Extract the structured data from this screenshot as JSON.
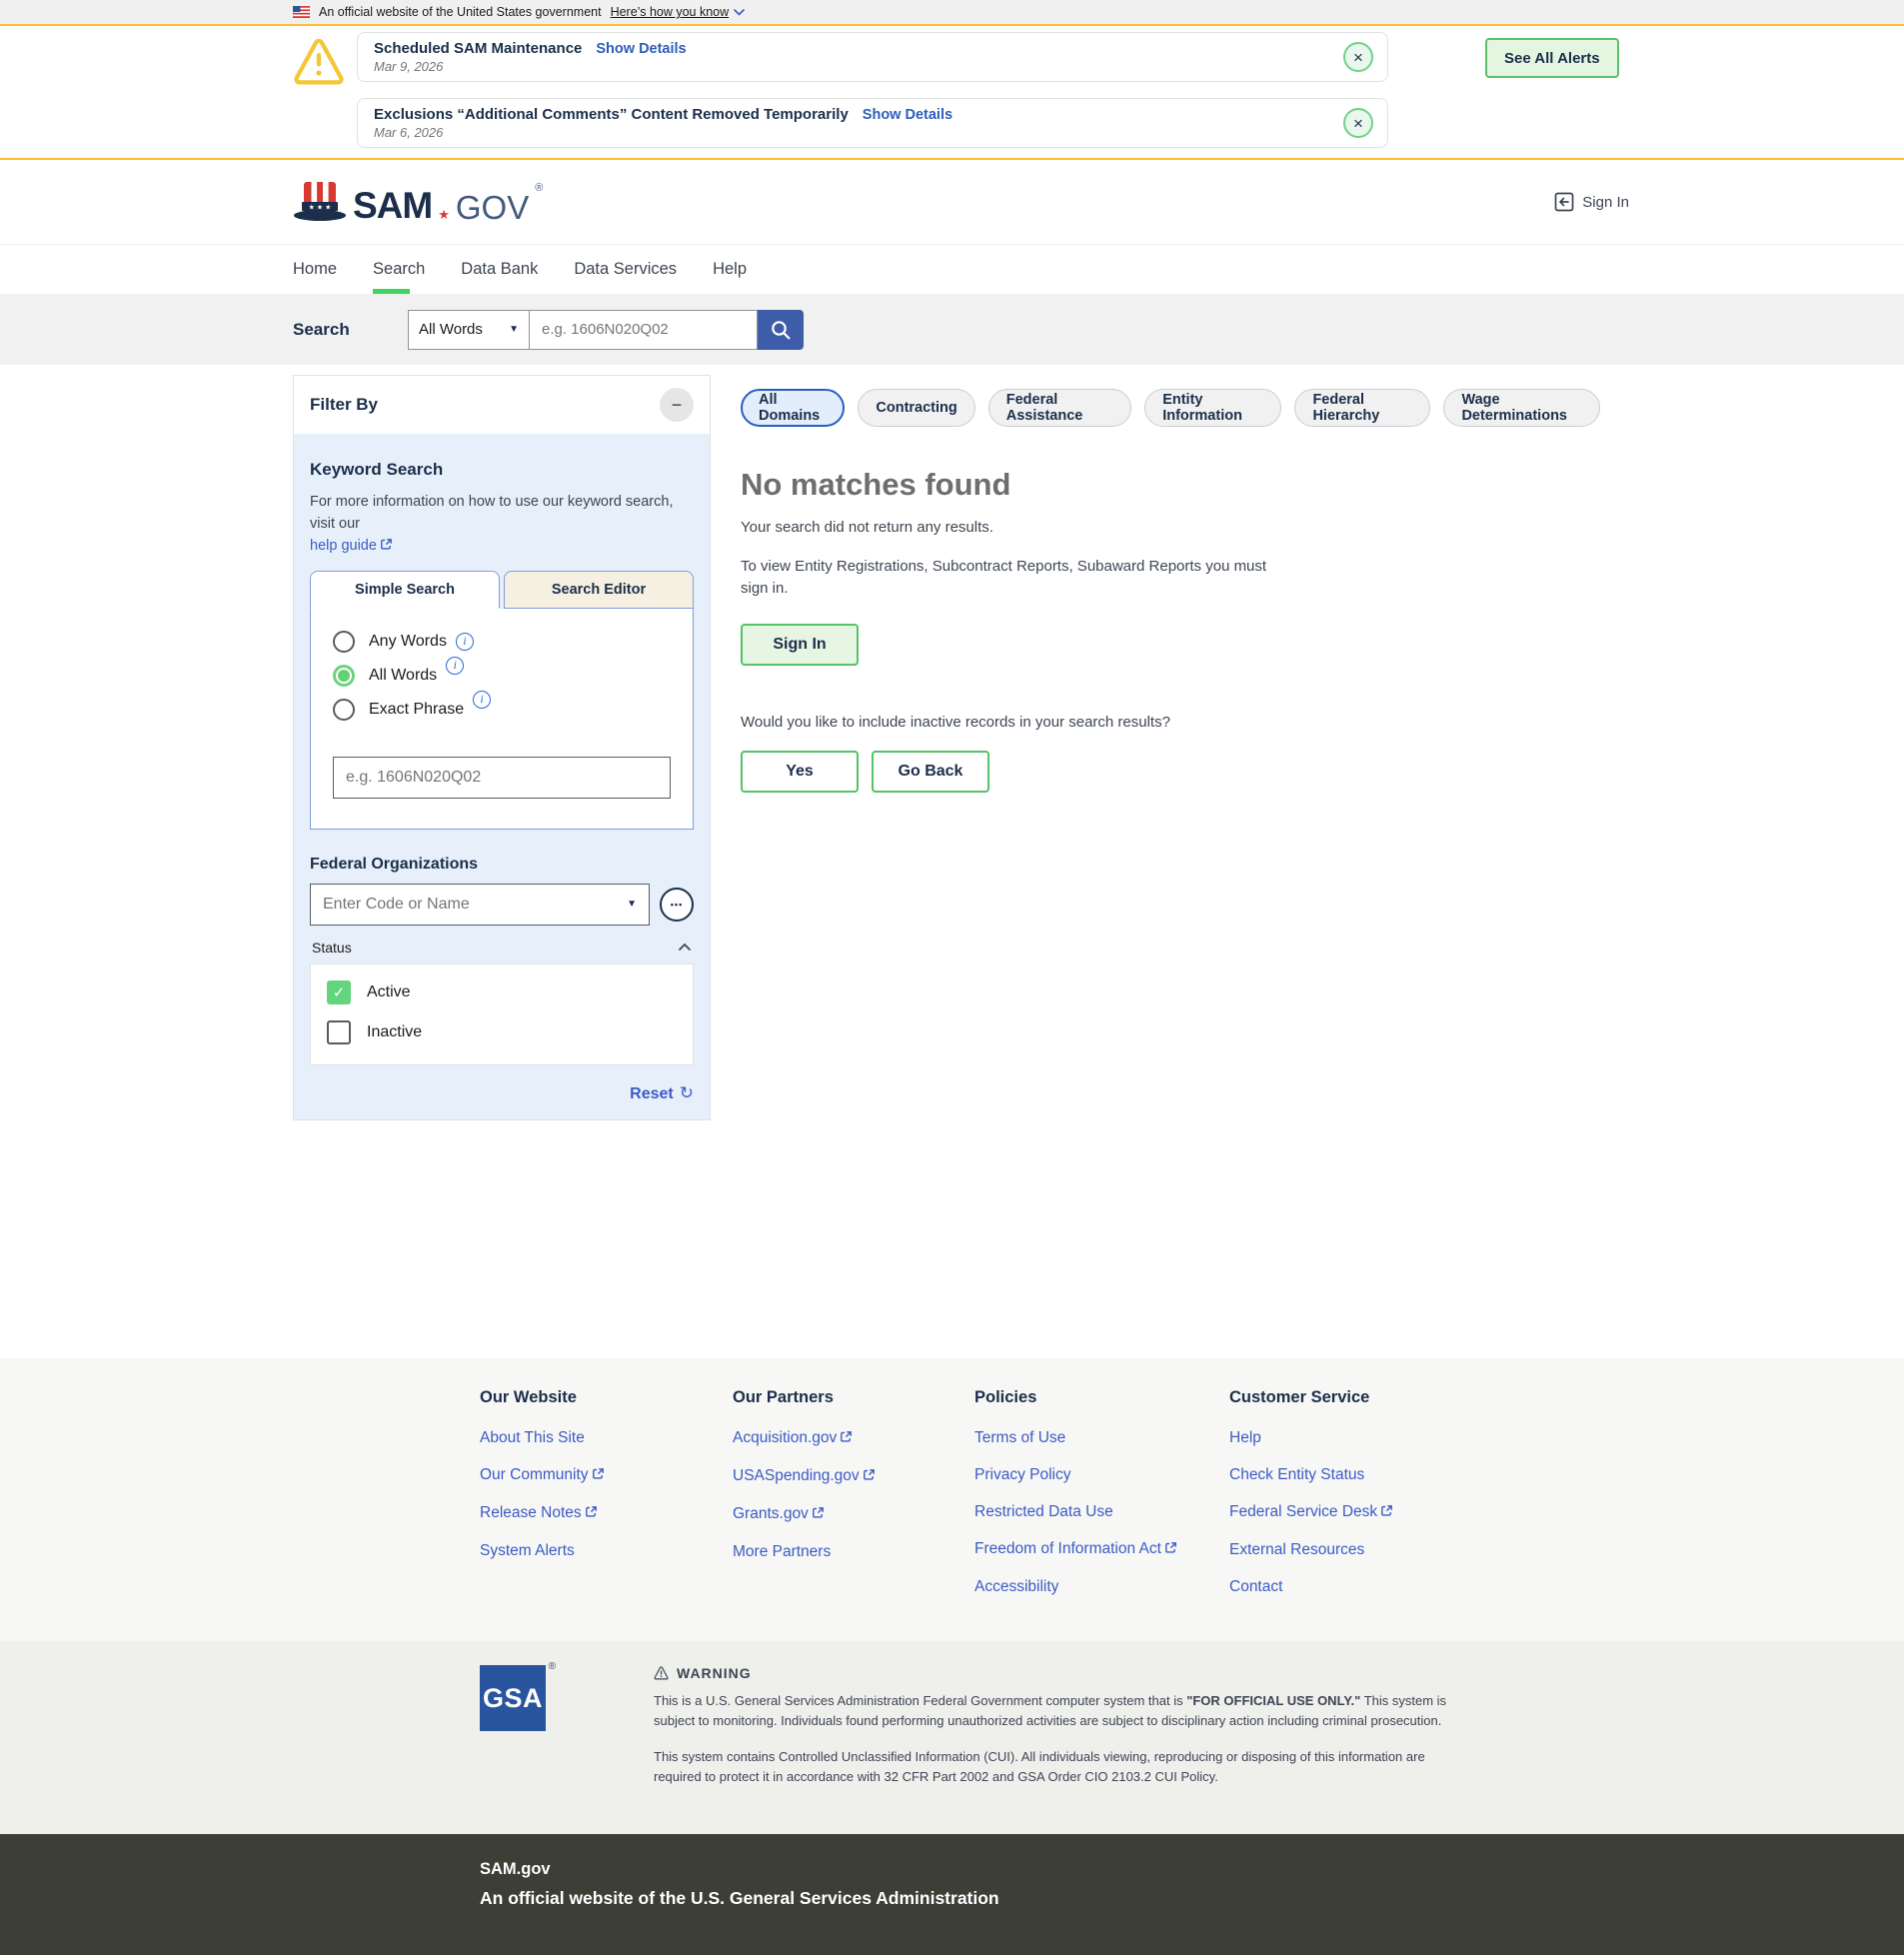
{
  "theme": {
    "accent_blue": "#3e5ca8",
    "gold": "#ffbe2e",
    "green": "#5ec16a",
    "bright_green": "#40d35f",
    "link_blue": "#3b5bc4",
    "navy": "#1b2e4a",
    "footer_dark": "#3d3e36",
    "gsa_blue": "#29549e"
  },
  "icons": {
    "close": "×",
    "minus": "−",
    "caret_down": "▼",
    "ellipsis": "•••",
    "check": "✓",
    "reset": "↻",
    "info": "i",
    "reg": "®"
  },
  "banner": {
    "text": "An official website of the United States government",
    "link": "Here’s how you know"
  },
  "alerts": {
    "items": [
      {
        "title": "Scheduled SAM Maintenance",
        "details_link": "Show Details",
        "date": "Mar 9, 2026"
      },
      {
        "title": "Exclusions “Additional Comments” Content Removed Temporarily",
        "details_link": "Show Details",
        "date": "Mar 6, 2026"
      }
    ],
    "see_all": "See All Alerts"
  },
  "header": {
    "logo": {
      "sam": "SAM",
      "gov": "GOV"
    },
    "sign_in": "Sign In"
  },
  "nav": {
    "items": [
      {
        "label": "Home"
      },
      {
        "label": "Search",
        "active": true
      },
      {
        "label": "Data Bank"
      },
      {
        "label": "Data Services"
      },
      {
        "label": "Help"
      }
    ]
  },
  "search_bar": {
    "label": "Search",
    "mode": "All Words",
    "placeholder": "e.g. 1606N020Q02"
  },
  "filter": {
    "title": "Filter By",
    "keyword": {
      "heading": "Keyword Search",
      "desc": "For more information on how to use our keyword search, visit our",
      "help_link": "help guide",
      "tabs": [
        {
          "label": "Simple Search",
          "active": true
        },
        {
          "label": "Search Editor",
          "active": false
        }
      ],
      "options": [
        {
          "label": "Any Words",
          "selected": false
        },
        {
          "label": "All Words",
          "selected": true
        },
        {
          "label": "Exact Phrase",
          "selected": false
        }
      ],
      "placeholder": "e.g. 1606N020Q02"
    },
    "orgs": {
      "heading": "Federal Organizations",
      "placeholder": "Enter Code or Name"
    },
    "status": {
      "label": "Status",
      "checkboxes": [
        {
          "label": "Active",
          "checked": true
        },
        {
          "label": "Inactive",
          "checked": false
        }
      ]
    },
    "reset": "Reset"
  },
  "main": {
    "domains": [
      {
        "label": "All Domains",
        "active": true
      },
      {
        "label": "Contracting",
        "active": false
      },
      {
        "label": "Federal Assistance",
        "active": false
      },
      {
        "label": "Entity Information",
        "active": false
      },
      {
        "label": "Federal Hierarchy",
        "active": false
      },
      {
        "label": "Wage Determinations",
        "active": false
      }
    ],
    "heading": "No matches found",
    "message": "Your search did not return any results.",
    "sign_in_note": "To view Entity Registrations, Subcontract Reports, Subaward Reports you must sign in.",
    "sign_in": "Sign In",
    "question": "Would you like to include inactive records in your search results?",
    "yes": "Yes",
    "go_back": "Go Back"
  },
  "footer": {
    "columns": [
      {
        "title": "Our Website",
        "links": [
          {
            "label": "About This Site",
            "external": false
          },
          {
            "label": "Our Community",
            "external": true
          },
          {
            "label": "Release Notes",
            "external": true
          },
          {
            "label": "System Alerts",
            "external": false
          }
        ]
      },
      {
        "title": "Our Partners",
        "links": [
          {
            "label": "Acquisition.gov",
            "external": true
          },
          {
            "label": "USASpending.gov",
            "external": true
          },
          {
            "label": "Grants.gov",
            "external": true
          },
          {
            "label": "More Partners",
            "external": false
          }
        ]
      },
      {
        "title": "Policies",
        "links": [
          {
            "label": "Terms of Use",
            "external": false
          },
          {
            "label": "Privacy Policy",
            "external": false
          },
          {
            "label": "Restricted Data Use",
            "external": false
          },
          {
            "label": "Freedom of Information Act",
            "external": true
          },
          {
            "label": "Accessibility",
            "external": false
          }
        ]
      },
      {
        "title": "Customer Service",
        "links": [
          {
            "label": "Help",
            "external": false
          },
          {
            "label": "Check Entity Status",
            "external": false
          },
          {
            "label": "Federal Service Desk",
            "external": true
          },
          {
            "label": "External Resources",
            "external": false
          },
          {
            "label": "Contact",
            "external": false
          }
        ]
      }
    ],
    "gsa": "GSA",
    "warning": {
      "heading": "WARNING",
      "p1_pre": "This is a U.S. General Services Administration Federal Government computer system that is ",
      "p1_bold": "\"FOR OFFICIAL USE ONLY.\"",
      "p1_post": " This system is subject to monitoring. Individuals found performing unauthorized activities are subject to disciplinary action including criminal prosecution.",
      "p2": "This system contains Controlled Unclassified Information (CUI). All individuals viewing, reproducing or disposing of this information are required to protect it in accordance with 32 CFR Part 2002 and GSA Order CIO 2103.2 CUI Policy."
    }
  },
  "site_footer": {
    "name": "SAM.gov",
    "tagline": "An official website of the U.S. General Services Administration"
  }
}
